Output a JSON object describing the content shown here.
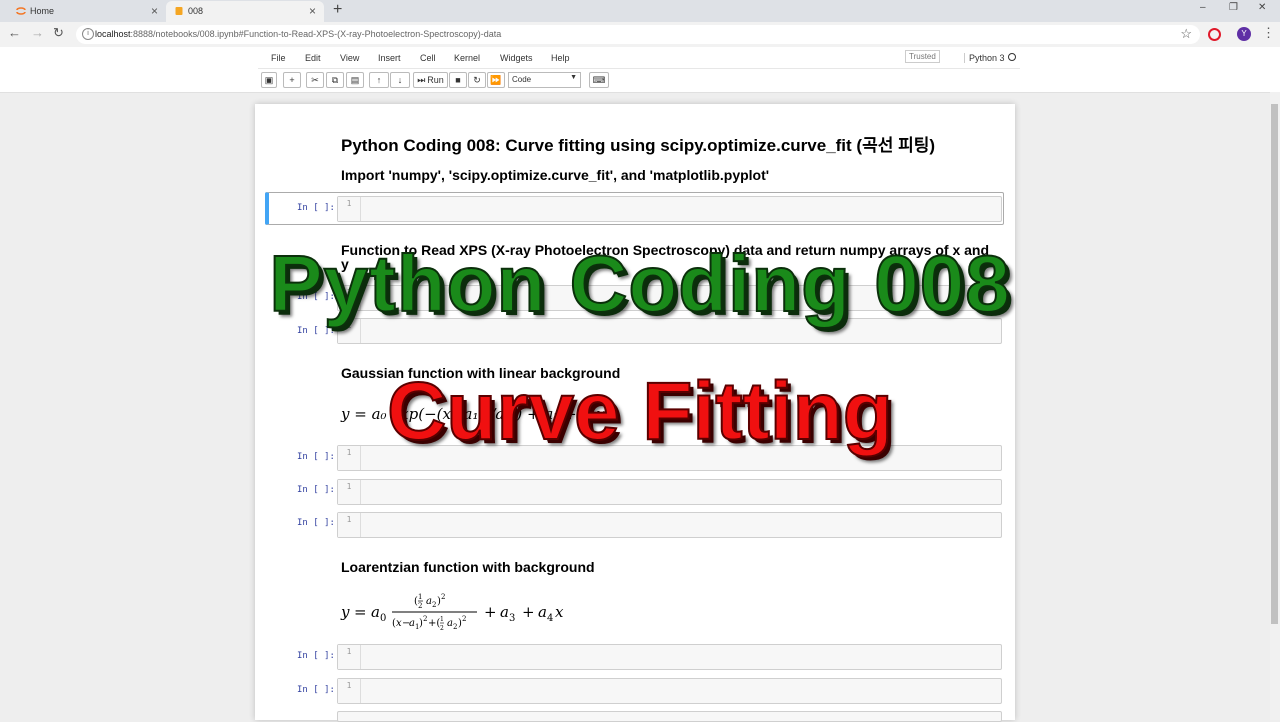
{
  "browser": {
    "tabs": [
      {
        "title": "Home",
        "active": false
      },
      {
        "title": "008",
        "active": true
      }
    ],
    "url_host": "localhost",
    "url_rest": ":8888/notebooks/008.ipynb#Function-to-Read-XPS-(X-ray-Photoelectron-Spectroscopy)-data",
    "profile_initial": "Y"
  },
  "jupyter": {
    "menu": [
      "File",
      "Edit",
      "View",
      "Insert",
      "Cell",
      "Kernel",
      "Widgets",
      "Help"
    ],
    "trusted_label": "Trusted",
    "kernel_name": "Python 3",
    "run_label": "Run",
    "cell_type": "Code"
  },
  "cells": {
    "prompt": "In [ ]:",
    "line_number": "1"
  },
  "notebook": {
    "title": "Python Coding 008: Curve fitting using scipy.optimize.curve_fit (곡선 피팅)",
    "import_heading": "Import 'numpy', 'scipy.optimize.curve_fit', and 'matplotlib.pyplot'",
    "read_heading": "Function to Read XPS (X-ray Photoelectron Spectroscopy) data and return numpy arrays of x and y",
    "gaussian_heading": "Gaussian function with linear background",
    "gaussian_eq": "y = a₀ exp(−(x−a₁)²/a₂²) + a₃ + a₄x",
    "lorentzian_heading": "Loarentzian function with background"
  },
  "overlay": {
    "line1": "Python Coding 008",
    "line2": "Curve Fitting"
  },
  "colors": {
    "overlay_green": "#1a8a1a",
    "overlay_red": "#f01010",
    "selected_cell_border": "#42a5f5"
  }
}
